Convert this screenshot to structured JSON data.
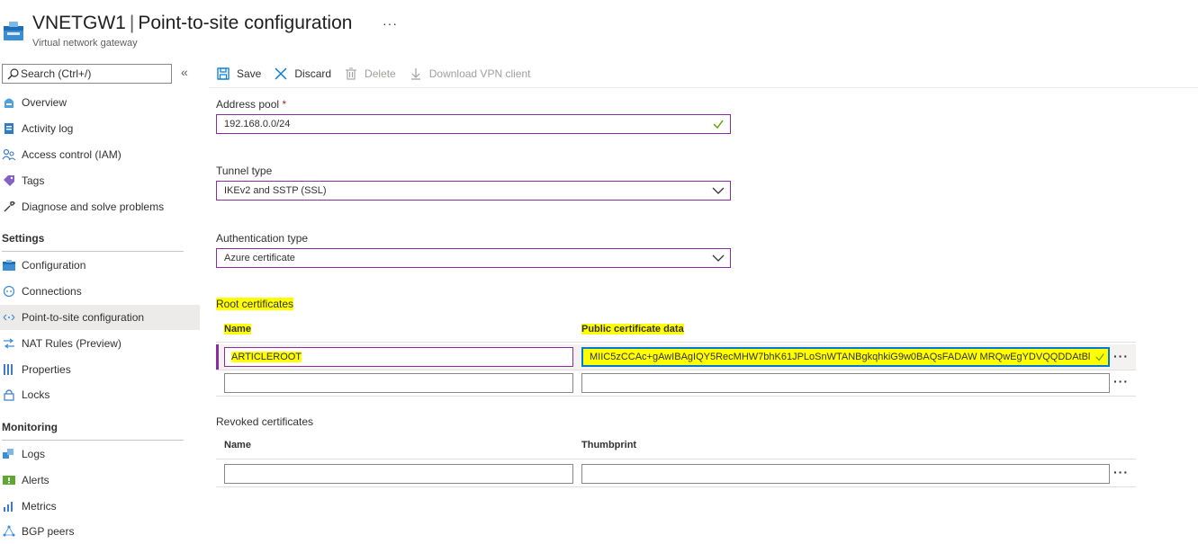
{
  "header": {
    "resource_name": "VNETGW1",
    "separator": "|",
    "page_title": "Point-to-site configuration",
    "subtitle": "Virtual network gateway",
    "more": "···"
  },
  "sidebar": {
    "search_placeholder": "Search (Ctrl+/)",
    "collapse": "«",
    "items": [
      {
        "label": "Overview",
        "icon": "overview-icon"
      },
      {
        "label": "Activity log",
        "icon": "activity-log-icon"
      },
      {
        "label": "Access control (IAM)",
        "icon": "iam-icon"
      },
      {
        "label": "Tags",
        "icon": "tag-icon"
      },
      {
        "label": "Diagnose and solve problems",
        "icon": "wrench-icon"
      }
    ],
    "settings_header": "Settings",
    "settings_items": [
      {
        "label": "Configuration",
        "icon": "configuration-icon"
      },
      {
        "label": "Connections",
        "icon": "connections-icon"
      },
      {
        "label": "Point-to-site configuration",
        "icon": "point-to-site-icon",
        "active": true
      },
      {
        "label": "NAT Rules (Preview)",
        "icon": "nat-rules-icon"
      },
      {
        "label": "Properties",
        "icon": "properties-icon"
      },
      {
        "label": "Locks",
        "icon": "lock-icon"
      }
    ],
    "monitoring_header": "Monitoring",
    "monitoring_items": [
      {
        "label": "Logs",
        "icon": "logs-icon"
      },
      {
        "label": "Alerts",
        "icon": "alerts-icon"
      },
      {
        "label": "Metrics",
        "icon": "metrics-icon"
      },
      {
        "label": "BGP peers",
        "icon": "bgp-peers-icon"
      }
    ]
  },
  "toolbar": {
    "save": "Save",
    "discard": "Discard",
    "delete": "Delete",
    "download": "Download VPN client"
  },
  "form": {
    "address_pool_label": "Address pool",
    "required_mark": "*",
    "address_pool_value": "192.168.0.0/24",
    "tunnel_type_label": "Tunnel type",
    "tunnel_type_value": "IKEv2 and SSTP (SSL)",
    "auth_type_label": "Authentication type",
    "auth_type_value": "Azure certificate"
  },
  "root_certificates": {
    "title": "Root certificates",
    "col_name": "Name",
    "col_data": "Public certificate data",
    "rows": [
      {
        "name": "ARTICLEROOT",
        "data": "MIIC5zCCAc+gAwIBAgIQY5RecMHW7bhK61JPLoSnWTANBgkqhkiG9w0BAQsFADAW MRQwEgYDVQQDDAtBl"
      },
      {
        "name": "",
        "data": ""
      }
    ],
    "more": "···"
  },
  "revoked_certificates": {
    "title": "Revoked certificates",
    "col_name": "Name",
    "col_thumbprint": "Thumbprint",
    "rows": [
      {
        "name": "",
        "thumbprint": ""
      }
    ],
    "more": "···"
  },
  "colors": {
    "accent_purple": "#8a2da5",
    "highlight": "#ffff00",
    "azure_blue": "#0078d4"
  }
}
